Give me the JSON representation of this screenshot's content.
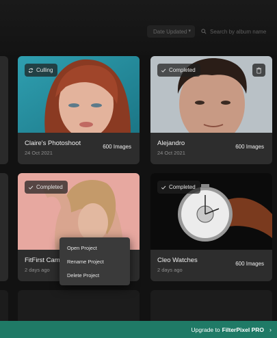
{
  "toolbar": {
    "sort_label": "Date Updated",
    "search_placeholder": "Search by album name"
  },
  "projects": [
    {
      "title": "Claire's Photoshoot",
      "date": "24 Oct 2021",
      "count": "600 Images",
      "status": "Culling"
    },
    {
      "title": "Alejandro",
      "date": "24 Oct 2021",
      "count": "600 Images",
      "status": "Completed"
    },
    {
      "title": "FitFirst Campa",
      "date": "2 days ago",
      "count": "",
      "status": "Completed"
    },
    {
      "title": "Cleo Watches",
      "date": "2 days ago",
      "count": "600 Images",
      "status": "Completed"
    }
  ],
  "context_menu": {
    "items": [
      "Open Project",
      "Rename Project",
      "Delete Project"
    ]
  },
  "upgrade": {
    "prefix": "Upgrade to",
    "product": "FilterPixel PRO"
  },
  "colors": {
    "accent": "#1f7a66",
    "card_bg": "#2d2d2d",
    "page_bg": "#121212"
  },
  "icons": [
    "search-icon",
    "chevron-down-icon",
    "sync-icon",
    "check-icon",
    "trash-icon",
    "chevron-right-icon"
  ]
}
